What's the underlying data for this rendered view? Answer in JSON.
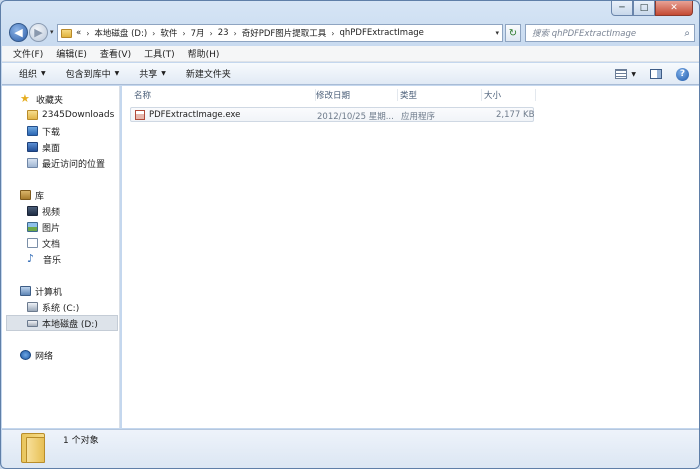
{
  "window": {
    "controls": {
      "minimize": "─",
      "maximize": "□",
      "close": "✕"
    }
  },
  "address_bar": {
    "prefix": "«",
    "crumbs": [
      "本地磁盘 (D:)",
      "软件",
      "7月",
      "23",
      "奇好PDF图片提取工具",
      "qhPDFExtractImage"
    ],
    "separator": "›",
    "dropdown": "▾"
  },
  "search": {
    "placeholder": "搜索 qhPDFExtractImage",
    "icon": "search-icon"
  },
  "menu": {
    "items": [
      "文件(F)",
      "编辑(E)",
      "查看(V)",
      "工具(T)",
      "帮助(H)"
    ]
  },
  "toolbar": {
    "organize": "组织",
    "include_in_library": "包含到库中",
    "share": "共享",
    "new_folder": "新建文件夹",
    "arrow": "▼",
    "help": "?"
  },
  "nav": {
    "favorites": {
      "label": "收藏夹",
      "items": [
        "2345Downloads",
        "下载",
        "桌面",
        "最近访问的位置"
      ]
    },
    "libraries": {
      "label": "库",
      "items": [
        "视频",
        "图片",
        "文档",
        "音乐"
      ]
    },
    "computer": {
      "label": "计算机",
      "items": [
        "系统 (C:)",
        "本地磁盘 (D:)"
      ]
    },
    "network": {
      "label": "网络"
    }
  },
  "columns": {
    "name": "名称",
    "modified": "修改日期",
    "type": "类型",
    "size": "大小"
  },
  "files": [
    {
      "name": "PDFExtractImage.exe",
      "modified": "2012/10/25 星期...",
      "type": "应用程序",
      "size": "2,177 KB"
    }
  ],
  "status": {
    "count": "1 个对象"
  },
  "colors": {
    "accent": "#2d5ea8",
    "window_frame": "#c4d7ee",
    "close": "#c44a33"
  }
}
